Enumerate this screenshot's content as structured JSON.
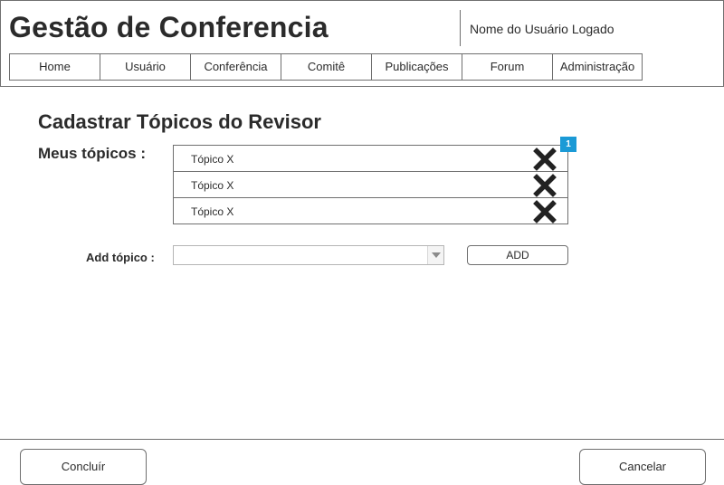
{
  "header": {
    "app_title": "Gestão de Conferencia",
    "user_name": "Nome do Usuário Logado"
  },
  "nav": {
    "items": [
      {
        "label": "Home"
      },
      {
        "label": "Usuário"
      },
      {
        "label": "Conferência"
      },
      {
        "label": "Comitê"
      },
      {
        "label": "Publicações"
      },
      {
        "label": "Forum"
      },
      {
        "label": "Administração"
      }
    ]
  },
  "main": {
    "page_title": "Cadastrar Tópicos do Revisor",
    "topics_label": "Meus tópicos :",
    "topics": [
      {
        "label": "Tópico X",
        "remove_icon": "close-x-icon"
      },
      {
        "label": "Tópico X",
        "remove_icon": "close-x-icon"
      },
      {
        "label": "Tópico X",
        "remove_icon": "close-x-icon"
      }
    ],
    "badge": "1",
    "badge_color": "#1b9ad6",
    "add_label": "Add tópico :",
    "add_select_value": "",
    "add_button_label": "ADD"
  },
  "footer": {
    "confirm_label": "Concluír",
    "cancel_label": "Cancelar"
  }
}
